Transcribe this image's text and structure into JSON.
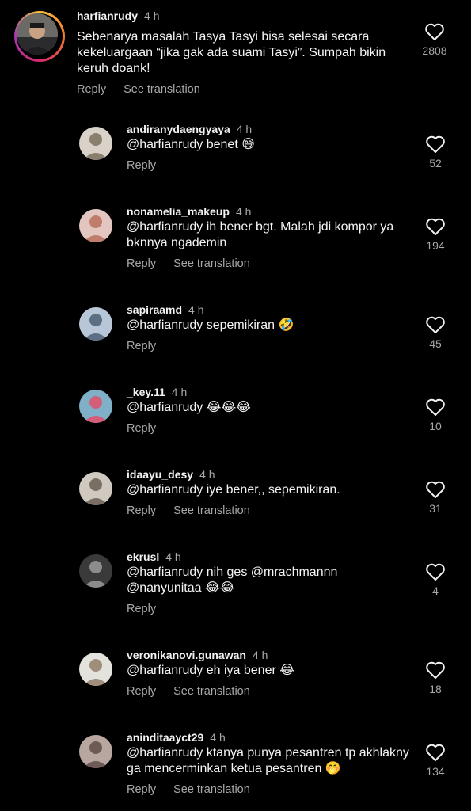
{
  "reply_label": "Reply",
  "translate_label": "See translation",
  "main_comment": {
    "username": "harfianrudy",
    "time": "4 h",
    "text": "Sebenarya masalah Tasya Tasyi bisa selesai secara kekeluargaan “jika gak ada suami Tasyi”. Sumpah bikin keruh doank!",
    "likes": "2808"
  },
  "replies": [
    {
      "username": "andiranydaengyaya",
      "time": "4 h",
      "text": "@harfianrudy benet",
      "emoji": "😅",
      "likes": "52",
      "translate": false
    },
    {
      "username": "nonamelia_makeup",
      "time": "4 h",
      "text": "@harfianrudy ih bener bgt. Malah jdi kompor ya bknnya ngademin",
      "emoji": "",
      "likes": "194",
      "translate": true
    },
    {
      "username": "sapiraamd",
      "time": "4 h",
      "text": "@harfianrudy sepemikiran",
      "emoji": "🤣",
      "likes": "45",
      "translate": false
    },
    {
      "username": "_key.11",
      "time": "4 h",
      "text": "@harfianrudy",
      "emoji": "😂😂😂",
      "likes": "10",
      "translate": false
    },
    {
      "username": "idaayu_desy",
      "time": "4 h",
      "text": "@harfianrudy iye bener,, sepemikiran.",
      "emoji": "",
      "likes": "31",
      "translate": true
    },
    {
      "username": "ekrusl",
      "time": "4 h",
      "text": "@harfianrudy nih ges @mrachmannn @nanyunitaa",
      "emoji": "😂😂",
      "likes": "4",
      "translate": false
    },
    {
      "username": "veronikanovi.gunawan",
      "time": "4 h",
      "text": "@harfianrudy eh iya bener",
      "emoji": "😂",
      "likes": "18",
      "translate": true
    },
    {
      "username": "aninditaayct29",
      "time": "4 h",
      "text": "@harfianrudy ktanya punya pesantren tp akhlakny ga mencerminkan ketua pesantren",
      "emoji": "🤭",
      "likes": "134",
      "translate": true
    }
  ],
  "colors": {
    "background": "#000000",
    "text": "#f5f5f5",
    "muted": "#a8a8a8"
  },
  "icons": {
    "like": "heart-outline-icon"
  }
}
